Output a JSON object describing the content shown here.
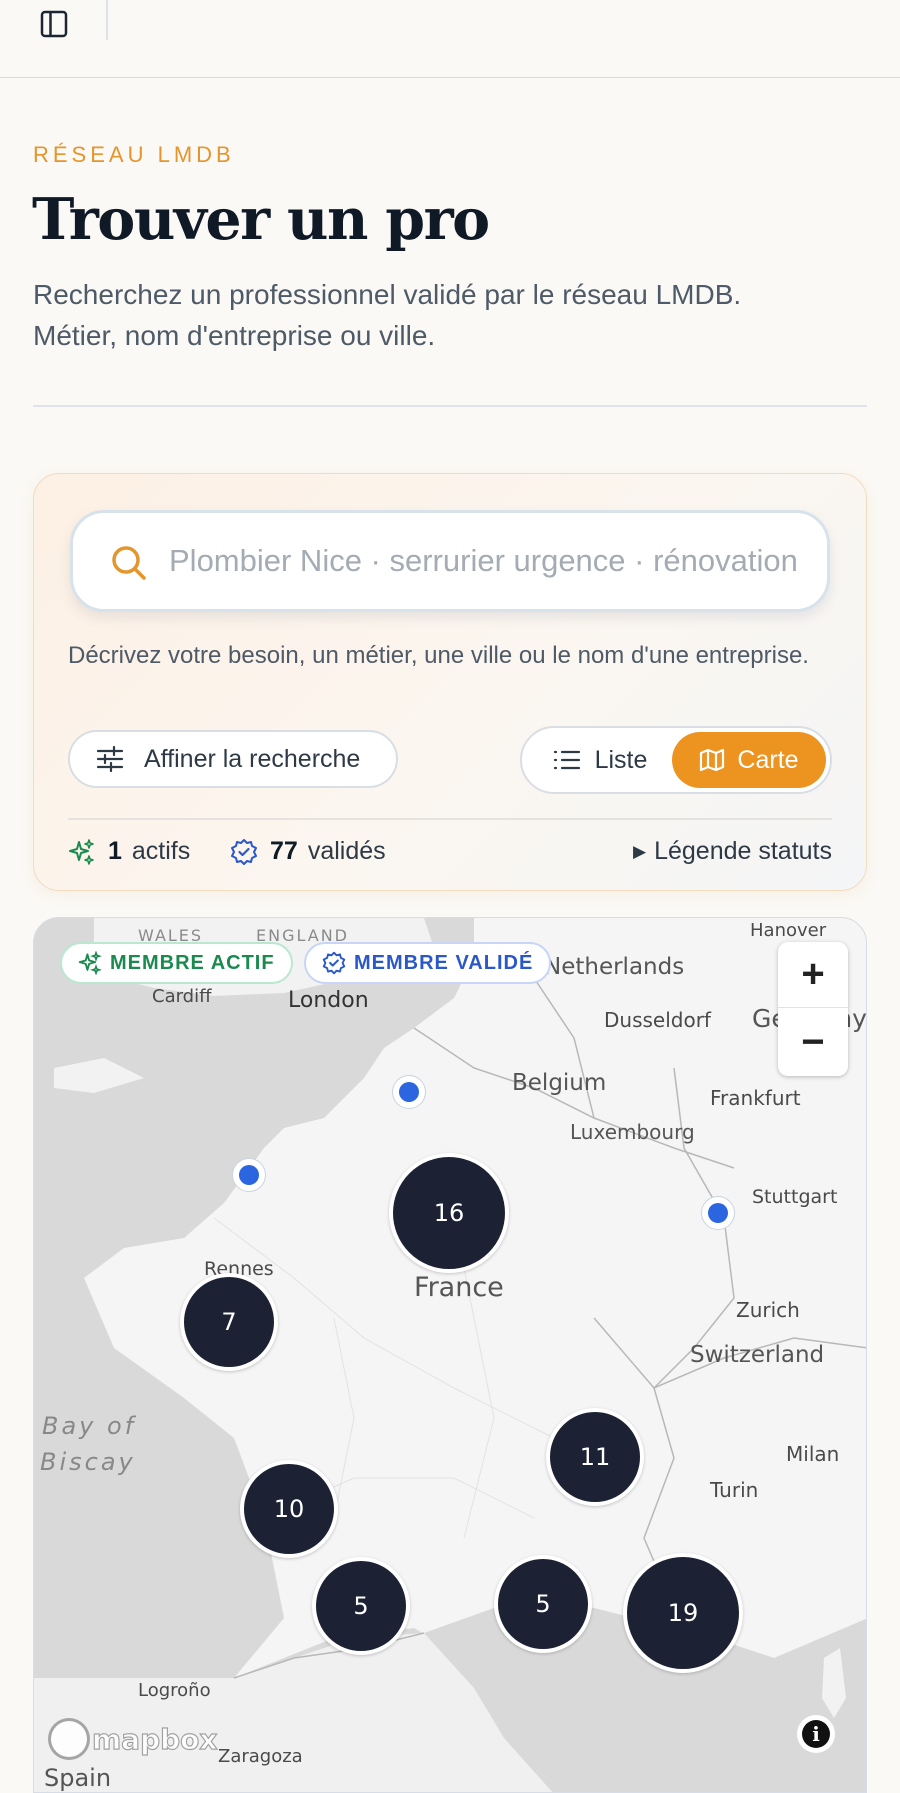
{
  "header": {
    "sidebar_toggle": "sidebar-toggle-icon"
  },
  "page": {
    "eyebrow": "RÉSEAU LMDB",
    "title": "Trouver un pro",
    "intro_line1": "Recherchez un professionnel validé par le réseau LMDB.",
    "intro_line2": "Métier, nom d'entreprise ou ville."
  },
  "search": {
    "placeholder": "Plombier Nice · serrurier urgence · rénovation",
    "value": "",
    "hint": "Décrivez votre besoin, un métier, une ville ou le nom d'une entreprise.",
    "refine_label": "Affiner la recherche",
    "view_list_label": "Liste",
    "view_map_label": "Carte",
    "active_view": "Carte"
  },
  "stats": {
    "active_count": "1",
    "active_label": "actifs",
    "valid_count": "77",
    "valid_label": "validés",
    "legend_label": "Légende statuts"
  },
  "map": {
    "badge_active": "MEMBRE ACTIF",
    "badge_valid": "MEMBRE VALIDÉ",
    "zoom_in": "+",
    "zoom_out": "−",
    "attribution": "mapbox",
    "info": "i",
    "clusters": [
      {
        "count": "16"
      },
      {
        "count": "7"
      },
      {
        "count": "11"
      },
      {
        "count": "10"
      },
      {
        "count": "5"
      },
      {
        "count": "5"
      },
      {
        "count": "19"
      }
    ],
    "labels": {
      "wales": "WALES",
      "england": "ENGLAND",
      "hanover": "Hanover",
      "netherlands": "Netherlands",
      "cardiff": "Cardiff",
      "london": "London",
      "dusseldorf": "Dusseldorf",
      "germany": "Germany",
      "belgium": "Belgium",
      "frankfurt": "Frankfurt",
      "luxembourg": "Luxembourg",
      "stuttgart": "Stuttgart",
      "rennes": "Rennes",
      "france": "France",
      "zurich": "Zurich",
      "switzerland": "Switzerland",
      "bay_of": "Bay of",
      "biscay": "Biscay",
      "milan": "Milan",
      "turin": "Turin",
      "logrono": "Logroño",
      "zaragoza": "Zaragoza",
      "spain": "Spain"
    }
  },
  "colors": {
    "accent": "#ec9320",
    "active_green": "#1a8a4e",
    "valid_blue": "#2b58c9",
    "cluster": "#1c2233",
    "pin": "#2b65e0"
  }
}
